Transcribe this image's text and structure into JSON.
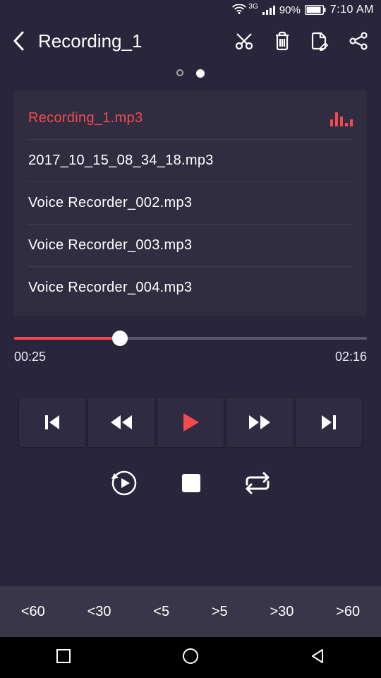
{
  "status": {
    "network_type": "3G",
    "battery_pct": "90%",
    "time": "7:10 AM"
  },
  "header": {
    "title": "Recording_1"
  },
  "pager": {
    "count": 2,
    "active": 1
  },
  "files": [
    {
      "name": "Recording_1.mp3",
      "active": true
    },
    {
      "name": "2017_10_15_08_34_18.mp3",
      "active": false
    },
    {
      "name": "Voice Recorder_002.mp3",
      "active": false
    },
    {
      "name": "Voice Recorder_003.mp3",
      "active": false
    },
    {
      "name": "Voice Recorder_004.mp3",
      "active": false
    }
  ],
  "playback": {
    "elapsed": "00:25",
    "total": "02:16",
    "progress_pct": 30
  },
  "skip_labels": [
    "<60",
    "<30",
    "<5",
    ">5",
    ">30",
    ">60"
  ],
  "colors": {
    "accent": "#f34a4f",
    "background": "#29253a"
  }
}
